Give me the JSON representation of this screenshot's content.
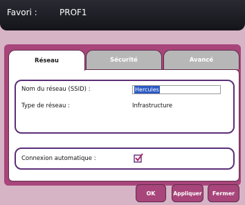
{
  "window": {
    "favorite_label": "Favori :",
    "favorite_value": "PROF1"
  },
  "tabs": [
    {
      "label": "Réseau",
      "active": true
    },
    {
      "label": "Sécurité",
      "active": false
    },
    {
      "label": "Avancé",
      "active": false
    }
  ],
  "network": {
    "ssid_label": "Nom du réseau (SSID) :",
    "ssid_value": "Hercules",
    "type_label": "Type de réseau :",
    "type_value": "Infrastructure"
  },
  "auto_connect": {
    "label": "Connexion automatique :",
    "checked": true
  },
  "buttons": {
    "ok": "OK",
    "apply": "Appliquer",
    "close": "Fermer"
  },
  "colors": {
    "accent": "#a8457b",
    "group_border": "#5b2d77",
    "titlebar": "#1c1c22",
    "inactive_tab": "#b7b7b7"
  }
}
